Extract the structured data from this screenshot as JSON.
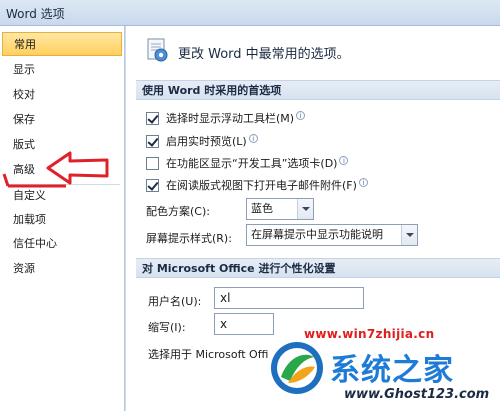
{
  "window": {
    "title": "Word 选项"
  },
  "sidebar": {
    "items": [
      {
        "label": "常用",
        "active": true
      },
      {
        "label": "显示"
      },
      {
        "label": "校对"
      },
      {
        "label": "保存"
      },
      {
        "label": "版式"
      },
      {
        "label": "高级"
      },
      {
        "label": "自定义"
      },
      {
        "label": "加载项"
      },
      {
        "label": "信任中心"
      },
      {
        "label": "资源"
      }
    ]
  },
  "header": {
    "text": "更改 Word 中最常用的选项。",
    "icon": "settings-page-icon"
  },
  "section1": {
    "title": "使用 Word 时采用的首选项",
    "options": [
      {
        "label": "选择时显示浮动工具栏(M)",
        "checked": true,
        "info": true
      },
      {
        "label": "启用实时预览(L)",
        "checked": true,
        "info": true
      },
      {
        "label": "在功能区显示“开发工具”选项卡(D)",
        "checked": false,
        "info": true
      },
      {
        "label": "在阅读版式视图下打开电子邮件附件(F)",
        "checked": true,
        "info": true
      }
    ],
    "color_scheme": {
      "label": "配色方案(C):",
      "value": "蓝色"
    },
    "tooltip_style": {
      "label": "屏幕提示样式(R):",
      "value": "在屏幕提示中显示功能说明"
    }
  },
  "section2": {
    "title": "对 Microsoft Office 进行个性化设置",
    "username": {
      "label": "用户名(U):",
      "value": "xl"
    },
    "initials": {
      "label": "缩写(I):",
      "value": "x"
    },
    "language_text": "选择用于 Microsoft Offi"
  },
  "watermark": {
    "url_top": "www.win7zhijia.cn",
    "name": "系统之家",
    "url_bottom": "www.Ghost123.com"
  },
  "colors": {
    "accent_arrow": "#e0202a",
    "active_nav": "#ffd05e",
    "section_bar": "#dbe5f1"
  }
}
